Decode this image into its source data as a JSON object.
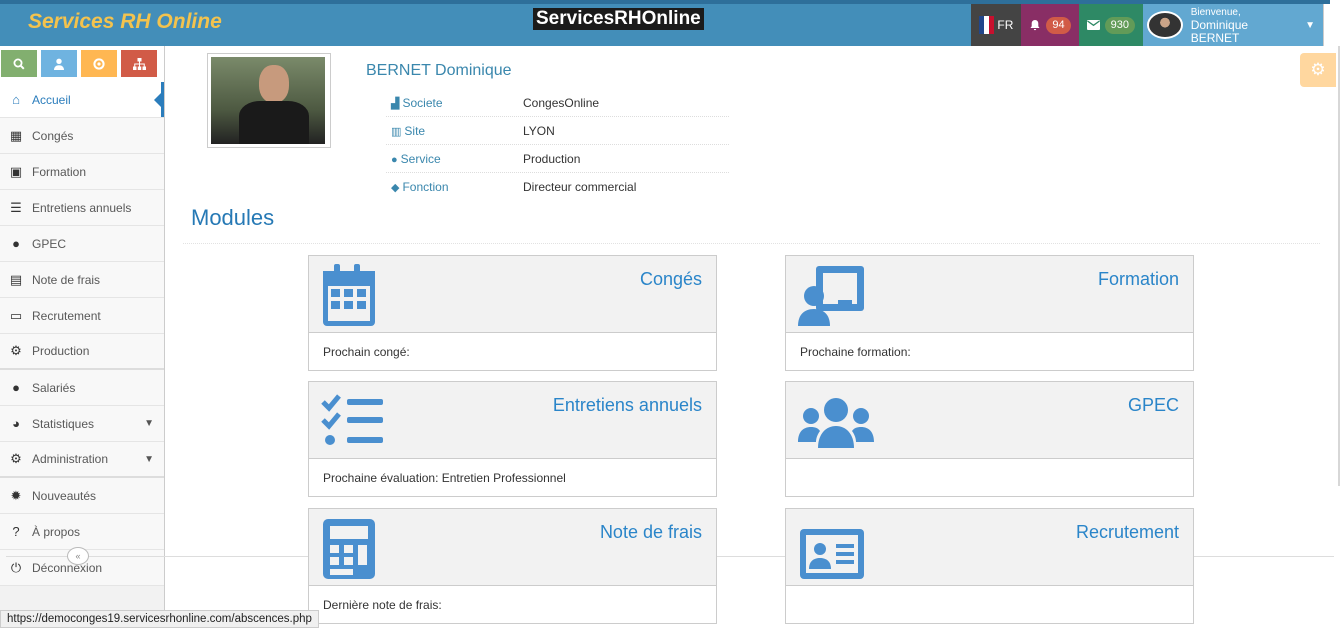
{
  "header": {
    "brand": "Services RH Online",
    "center_logo_part1": "ServicesRH",
    "center_logo_part2": "Online",
    "lang": "FR",
    "notifications_count": "94",
    "messages_count": "930",
    "welcome": "Bienvenue,",
    "user_name": "Dominique BERNET",
    "colors": {
      "navbar": "#438eb9",
      "brand": "#f3c34e",
      "notif": "#892e65",
      "mail": "#2e8965"
    }
  },
  "sidebar": {
    "shortcuts": [
      {
        "icon": "search-icon"
      },
      {
        "icon": "user-icon"
      },
      {
        "icon": "life-ring-icon"
      },
      {
        "icon": "sitemap-icon"
      }
    ],
    "items": [
      {
        "label": "Accueil",
        "icon": "home-icon"
      },
      {
        "label": "Congés",
        "icon": "calendar-icon"
      },
      {
        "label": "Formation",
        "icon": "chalkboard-teacher-icon"
      },
      {
        "label": "Entretiens annuels",
        "icon": "tasks-icon"
      },
      {
        "label": "GPEC",
        "icon": "users-icon"
      },
      {
        "label": "Note de frais",
        "icon": "calculator-icon"
      },
      {
        "label": "Recrutement",
        "icon": "id-card-icon"
      },
      {
        "label": "Production",
        "icon": "users-cog-icon"
      },
      {
        "label": "Salariés",
        "icon": "users-icon"
      },
      {
        "label": "Statistiques",
        "icon": "pie-chart-icon"
      },
      {
        "label": "Administration",
        "icon": "cogs-icon"
      },
      {
        "label": "Nouveautés",
        "icon": "certificate-icon"
      },
      {
        "label": "À propos",
        "icon": "question-circle-icon"
      },
      {
        "label": "Déconnexion",
        "icon": "power-off-icon"
      }
    ],
    "collapse_glyph": "«"
  },
  "status_url": "https://democonges19.servicesrhonline.com/abscences.php",
  "profile": {
    "name": "BERNET Dominique",
    "rows": [
      {
        "label": "Societe",
        "value": "CongesOnline"
      },
      {
        "label": "Site",
        "value": "LYON"
      },
      {
        "label": "Service",
        "value": "Production"
      },
      {
        "label": "Fonction",
        "value": "Directeur commercial"
      }
    ]
  },
  "modules": {
    "title": "Modules",
    "cards": [
      {
        "title": "Congés",
        "footer": "Prochain congé:",
        "icon": "calendar-icon"
      },
      {
        "title": "Formation",
        "footer": "Prochaine formation:",
        "icon": "chalkboard-teacher-icon"
      },
      {
        "title": "Entretiens annuels",
        "footer": "Prochaine évaluation: Entretien Professionnel",
        "icon": "tasks-icon"
      },
      {
        "title": "GPEC",
        "footer": "",
        "icon": "users-icon"
      },
      {
        "title": "Note de frais",
        "footer": "Dernière note de frais:",
        "icon": "calculator-icon"
      },
      {
        "title": "Recrutement",
        "footer": "",
        "icon": "id-card-icon"
      }
    ]
  }
}
